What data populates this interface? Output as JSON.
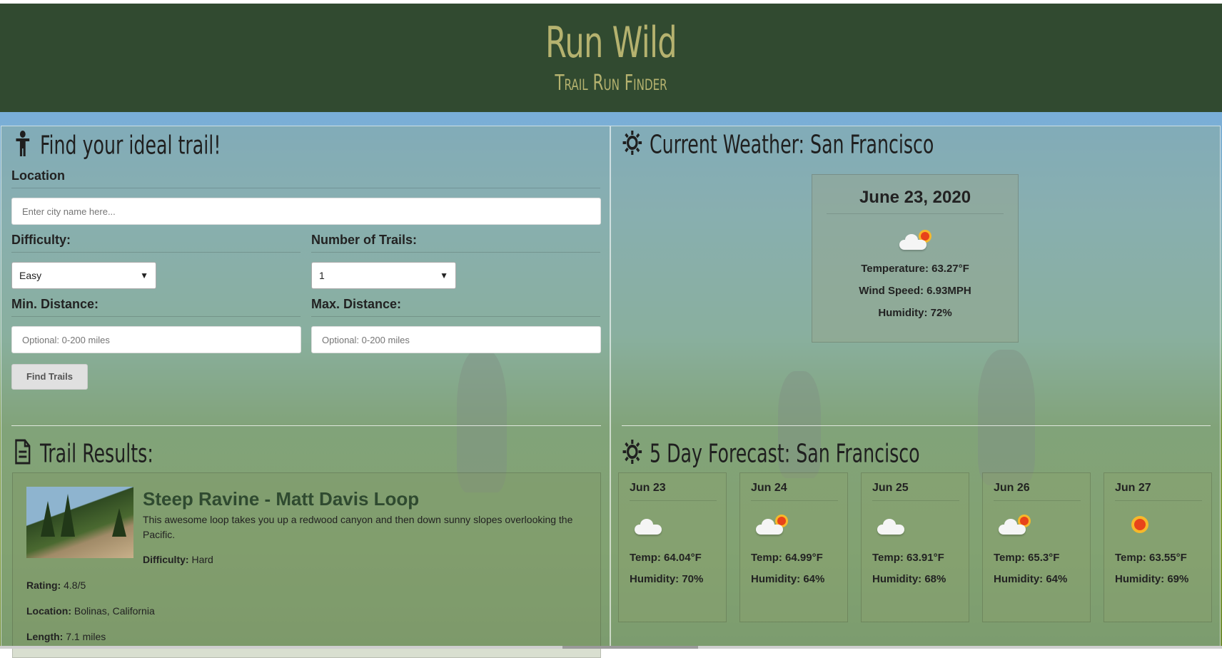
{
  "header": {
    "title": "Run Wild",
    "subtitle": "Trail Run Finder"
  },
  "search": {
    "section_title": "Find your ideal trail!",
    "section_icon": "child-icon",
    "location_label": "Location",
    "location_placeholder": "Enter city name here...",
    "difficulty_label": "Difficulty:",
    "difficulty_value": "Easy",
    "num_trails_label": "Number of Trails:",
    "num_trails_value": "1",
    "min_distance_label": "Min. Distance:",
    "min_distance_placeholder": "Optional: 0-200 miles",
    "max_distance_label": "Max. Distance:",
    "max_distance_placeholder": "Optional: 0-200 miles",
    "submit_label": "Find Trails"
  },
  "results": {
    "section_title": "Trail Results:",
    "section_icon": "file-text-icon",
    "trails": [
      {
        "name": "Steep Ravine - Matt Davis Loop",
        "description": "This awesome loop takes you up a redwood canyon and then down sunny slopes overlooking the Pacific.",
        "difficulty_label": "Difficulty:",
        "difficulty": "Hard",
        "rating_label": "Rating:",
        "rating": "4.8/5",
        "location_label": "Location:",
        "location": "Bolinas, California",
        "length_label": "Length:",
        "length": "7.1 miles"
      }
    ]
  },
  "weather": {
    "section_title": "Current Weather: San Francisco",
    "section_icon": "sun-icon",
    "date": "June 23, 2020",
    "icon": "partly-cloudy-icon",
    "temperature": "Temperature: 63.27°F",
    "wind": "Wind Speed: 6.93MPH",
    "humidity": "Humidity: 72%"
  },
  "forecast": {
    "section_title": "5 Day Forecast: San Francisco",
    "section_icon": "sun-icon",
    "days": [
      {
        "day": "Jun 23",
        "icon": "cloud-icon",
        "temp": "Temp: 64.04°F",
        "humidity": "Humidity: 70%"
      },
      {
        "day": "Jun 24",
        "icon": "partly-cloudy-icon",
        "temp": "Temp: 64.99°F",
        "humidity": "Humidity: 64%"
      },
      {
        "day": "Jun 25",
        "icon": "cloud-icon",
        "temp": "Temp: 63.91°F",
        "humidity": "Humidity: 68%"
      },
      {
        "day": "Jun 26",
        "icon": "partly-cloudy-icon",
        "temp": "Temp: 65.3°F",
        "humidity": "Humidity: 64%"
      },
      {
        "day": "Jun 27",
        "icon": "sun-icon",
        "temp": "Temp: 63.55°F",
        "humidity": "Humidity: 69%"
      }
    ]
  },
  "colors": {
    "header_bg": "#314a30",
    "header_text": "#b5b26f",
    "accent_green": "#2f4a30"
  }
}
